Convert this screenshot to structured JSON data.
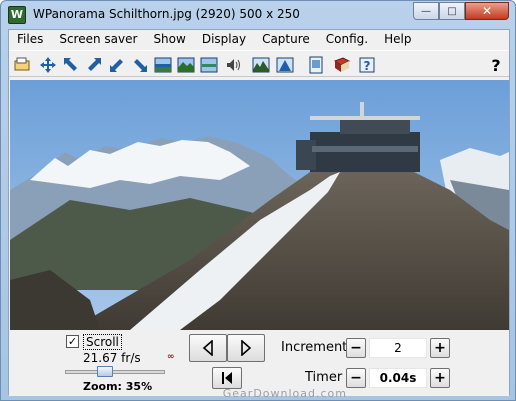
{
  "window": {
    "title": "WPanorama  Schilthorn.jpg  (2920) 500 x 250",
    "app_icon_letter": "W",
    "controls": [
      "minimize",
      "maximize",
      "close"
    ]
  },
  "menu": [
    "Files",
    "Screen saver",
    "Show",
    "Display",
    "Capture",
    "Config.",
    "Help"
  ],
  "toolbar": {
    "buttons": [
      "open-icon",
      "move-all-icon",
      "arrow-up-left-icon",
      "arrow-up-right-icon",
      "arrow-down-left-icon",
      "arrow-down-right-icon",
      "panorama-1-icon",
      "panorama-2-icon",
      "panorama-3-icon",
      "sound-icon",
      "landscape-1-icon",
      "landscape-2-icon",
      "page-icon",
      "book-icon",
      "info-icon"
    ],
    "help_label": "?"
  },
  "panorama": {
    "description_colors": {
      "sky": "#7aa7db",
      "rock": "#5f584f",
      "snow": "#eef1f4"
    }
  },
  "controls": {
    "scroll_checked": true,
    "scroll_label": "Scroll",
    "fps": "21.67 fr/s",
    "zoom": "Zoom: 35%",
    "increment_label": "Increment",
    "increment_value": "2",
    "timer_label": "Timer",
    "timer_value": "0.04s",
    "minus": "−",
    "plus": "+"
  },
  "watermark": "GearDownload.com",
  "colors": {
    "accent": "#1f5fa8",
    "panel": "#f0f0f0"
  }
}
